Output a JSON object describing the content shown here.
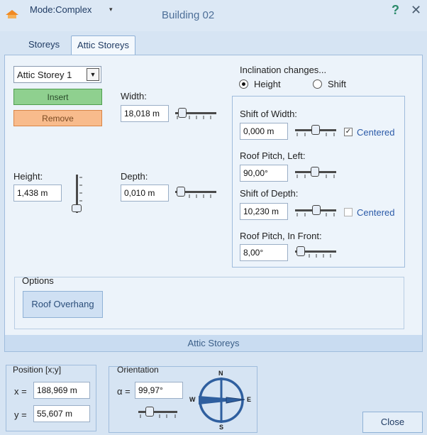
{
  "titlebar": {
    "mode_label": "Mode:Complex",
    "caret": "▾",
    "title": "Building 02",
    "help": "?",
    "close": "✕"
  },
  "tabs": [
    {
      "label": "Storeys",
      "active": false
    },
    {
      "label": "Attic Storeys",
      "active": true
    }
  ],
  "attic": {
    "storey_select": "Attic Storey 1",
    "insert_label": "Insert",
    "remove_label": "Remove",
    "width_label": "Width:",
    "width_value": "18,018 m",
    "depth_label": "Depth:",
    "depth_value": "0,010 m",
    "height_label": "Height:",
    "height_value": "1,438 m"
  },
  "inclination": {
    "title": "Inclination changes...",
    "radio_height": "Height",
    "radio_shift": "Shift",
    "selected": "Height",
    "shift_width_label": "Shift of Width:",
    "shift_width_value": "0,000 m",
    "centered_1_label": "Centered",
    "centered_1_checked": true,
    "roof_left_label": "Roof Pitch, Left:",
    "roof_left_value": "90,00°",
    "shift_depth_label": "Shift of Depth:",
    "shift_depth_value": "10,230 m",
    "centered_2_label": "Centered",
    "centered_2_checked": false,
    "roof_front_label": "Roof Pitch, In Front:",
    "roof_front_value": "8,00°"
  },
  "options": {
    "title": "Options",
    "roof_overhang_label": "Roof Overhang"
  },
  "panel_footer": "Attic Storeys",
  "position": {
    "title": "Position [x;y]",
    "x_label": "x =",
    "x_value": "188,969 m",
    "y_label": "y =",
    "y_value": "55,607 m"
  },
  "orientation": {
    "title": "Orientation",
    "alpha_label": "α =",
    "alpha_value": "99,97°",
    "compass": {
      "n": "N",
      "e": "E",
      "s": "S",
      "w": "W"
    }
  },
  "close_button": "Close",
  "colors": {
    "insert": "#8fd08f",
    "remove": "#f8bb8c",
    "accent": "#2b5aa8",
    "compass": "#2f5f9f"
  }
}
